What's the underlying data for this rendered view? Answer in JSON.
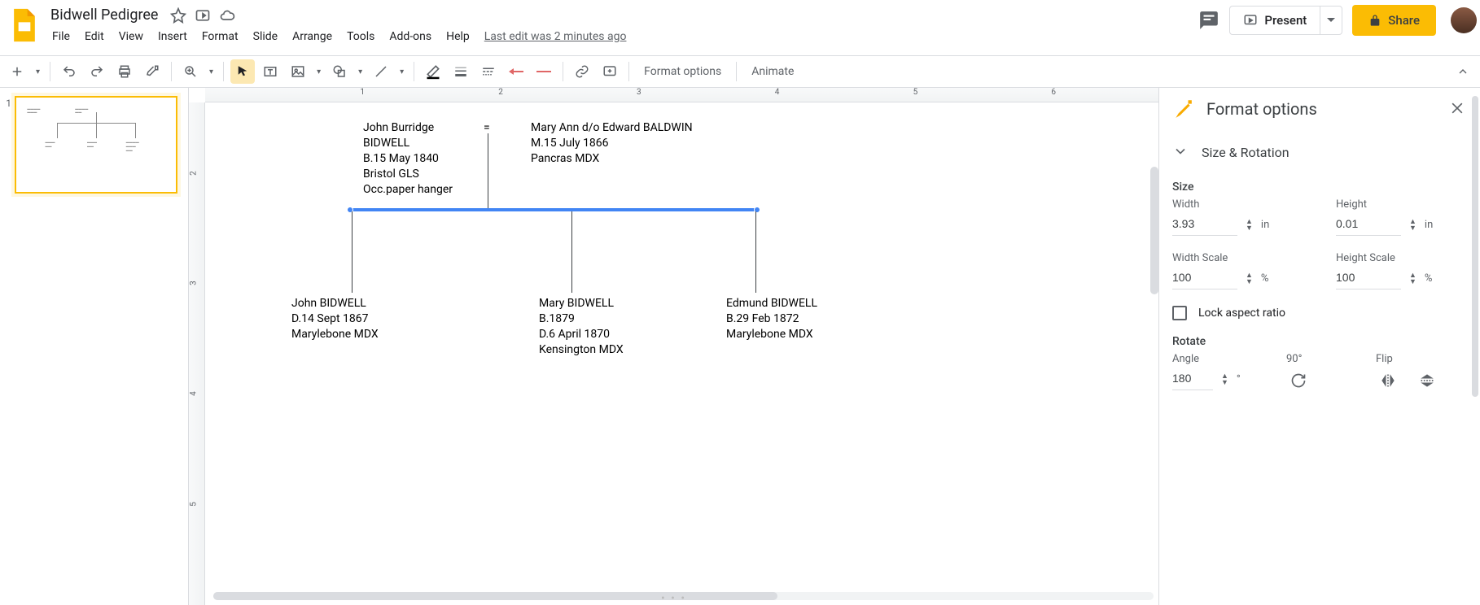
{
  "doc": {
    "title": "Bidwell Pedigree",
    "last_edit": "Last edit was 2 minutes ago"
  },
  "menus": [
    "File",
    "Edit",
    "View",
    "Insert",
    "Format",
    "Slide",
    "Arrange",
    "Tools",
    "Add-ons",
    "Help"
  ],
  "buttons": {
    "present": "Present",
    "share": "Share"
  },
  "ruler_h": [
    "1",
    "2",
    "3",
    "4",
    "5",
    "6"
  ],
  "ruler_v": [
    "2",
    "3",
    "4",
    "5"
  ],
  "toolbar": {
    "format_options": "Format options",
    "animate": "Animate"
  },
  "slide": {
    "person1": "John Burridge\nBIDWELL\nB.15 May 1840\nBristol GLS\nOcc.paper hanger",
    "eq": "=",
    "person2": "Mary Ann d/o Edward BALDWIN\nM.15 July 1866\nPancras MDX",
    "child1": "John BIDWELL\nD.14 Sept 1867\nMarylebone MDX",
    "child2": "Mary BIDWELL\nB.1879\nD.6 April 1870\nKensington MDX",
    "child3": "Edmund BIDWELL\nB.29 Feb 1872\nMarylebone MDX"
  },
  "sidebar": {
    "title": "Format options",
    "section": "Size & Rotation",
    "size_header": "Size",
    "width_label": "Width",
    "width_value": "3.93",
    "width_unit": "in",
    "height_label": "Height",
    "height_value": "0.01",
    "height_unit": "in",
    "width_scale_label": "Width Scale",
    "width_scale_value": "100",
    "width_scale_unit": "%",
    "height_scale_label": "Height Scale",
    "height_scale_value": "100",
    "height_scale_unit": "%",
    "lock_label": "Lock aspect ratio",
    "rotate_header": "Rotate",
    "angle_label": "Angle",
    "angle_value": "180",
    "angle_unit": "°",
    "ninety_label": "90°",
    "flip_label": "Flip"
  },
  "slide_number": "1"
}
